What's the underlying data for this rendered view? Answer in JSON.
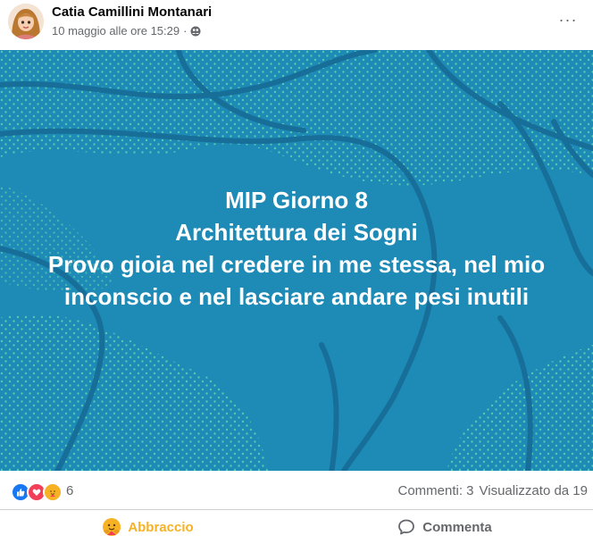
{
  "post": {
    "author": "Catia Camillini Montanari",
    "timestamp": "10 maggio alle ore 15:29",
    "separator": "·",
    "audience_icon": "friends-icon",
    "more_icon": "more-horizontal-icon",
    "more_label": "···"
  },
  "background_post": {
    "lines": [
      "MIP Giorno 8",
      "Architettura dei Sogni",
      "Provo gioia nel credere in me stessa, nel mio",
      "inconscio e nel lasciare andare pesi inutili"
    ],
    "background_color": "#1e8ab6",
    "dot_color": "#5fd4b0",
    "line_color": "#176f99"
  },
  "stats": {
    "reactions": [
      "like-icon",
      "love-icon",
      "care-icon"
    ],
    "reaction_count": "6",
    "comments": "Commenti: 3",
    "views": "Visualizzato da 19"
  },
  "actions": {
    "react_label": "Abbraccio",
    "comment_label": "Commenta",
    "react_color": "#f7b125"
  }
}
